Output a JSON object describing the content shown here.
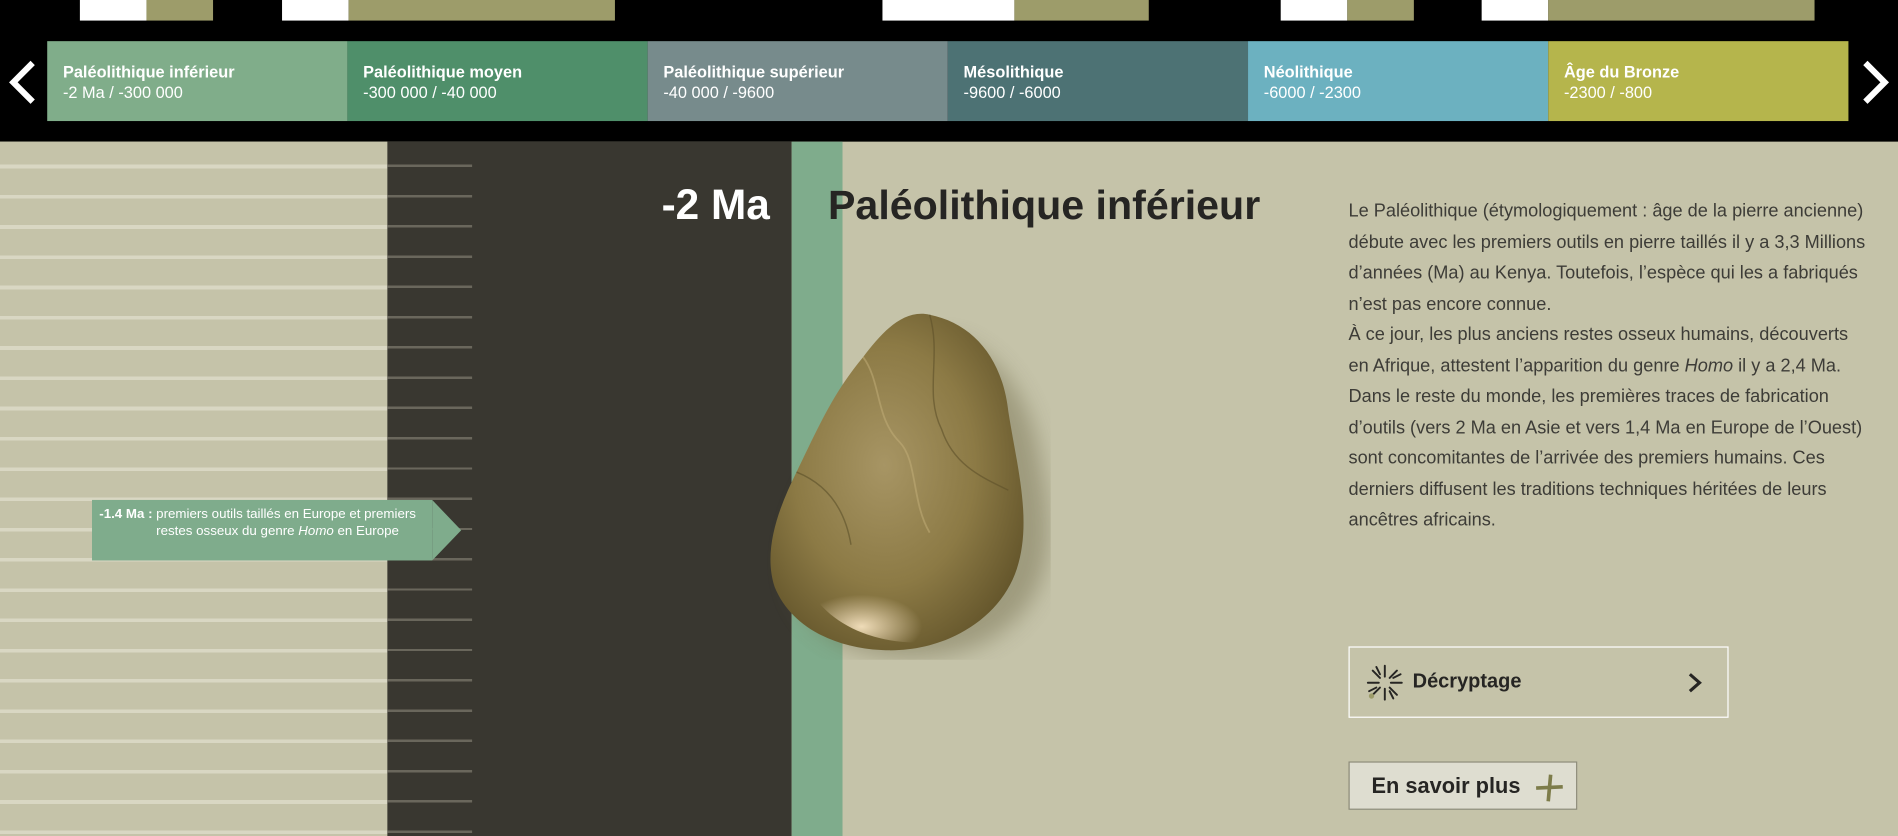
{
  "colors": {
    "green": "#7fac8c",
    "dark": "#393730",
    "beige": "#c5c3a9",
    "olive": "#9d9c6a"
  },
  "nav": {
    "prev_icon": "chevron-left-icon",
    "next_icon": "chevron-right-icon"
  },
  "periods": [
    {
      "name": "Paléolithique inférieur",
      "dates": "-2 Ma / -300 000",
      "color": "#80ad8a"
    },
    {
      "name": "Paléolithique moyen",
      "dates": "-300 000 / -40 000",
      "color": "#4f8f6a"
    },
    {
      "name": "Paléolithique supérieur",
      "dates": "-40 000 / -9600",
      "color": "#778b8c"
    },
    {
      "name": "Mésolithique",
      "dates": "-9600 / -6000",
      "color": "#4d7274"
    },
    {
      "name": "Néolithique",
      "dates": "-6000 / -2300",
      "color": "#6cb1c0"
    },
    {
      "name": "Âge du Bronze",
      "dates": "-2300 / -800",
      "color": "#b5b54c"
    }
  ],
  "event": {
    "date": "-1.4 Ma :",
    "text_before": "premiers outils taillés en Europe et premiers restes osseux du genre ",
    "text_italic": "Homo",
    "text_after": " en Europe"
  },
  "main": {
    "date": "-2 Ma",
    "title": "Paléolithique inférieur",
    "paragraphs": [
      {
        "before": "Le Paléolithique (étymologiquement : âge de la pierre ancienne) débute avec les premiers outils en pierre taillés il y a 3,3 Millions d’années (Ma) au Kenya. Toutefois, l’espèce qui les a fabriqués n’est pas encore connue.",
        "italic": "",
        "after": ""
      },
      {
        "before": "À ce jour, les plus anciens restes osseux humains, découverts en Afrique, attestent l’apparition du genre ",
        "italic": "Homo",
        "after": " il y a 2,4 Ma."
      },
      {
        "before": "Dans le reste du monde, les premières traces de fabrication d’outils (vers 2 Ma en Asie et vers 1,4 Ma en Europe de l’Ouest) sont concomitantes de l’arrivée des premiers humains. Ces derniers diffusent les traditions techniques héritées de leurs ancêtres africains.",
        "italic": "",
        "after": ""
      }
    ]
  },
  "buttons": {
    "decrypt_label": "Décryptage",
    "decrypt_icon": "sparkle-icon",
    "more_label": "En savoir plus",
    "more_icon": "plus-icon"
  }
}
